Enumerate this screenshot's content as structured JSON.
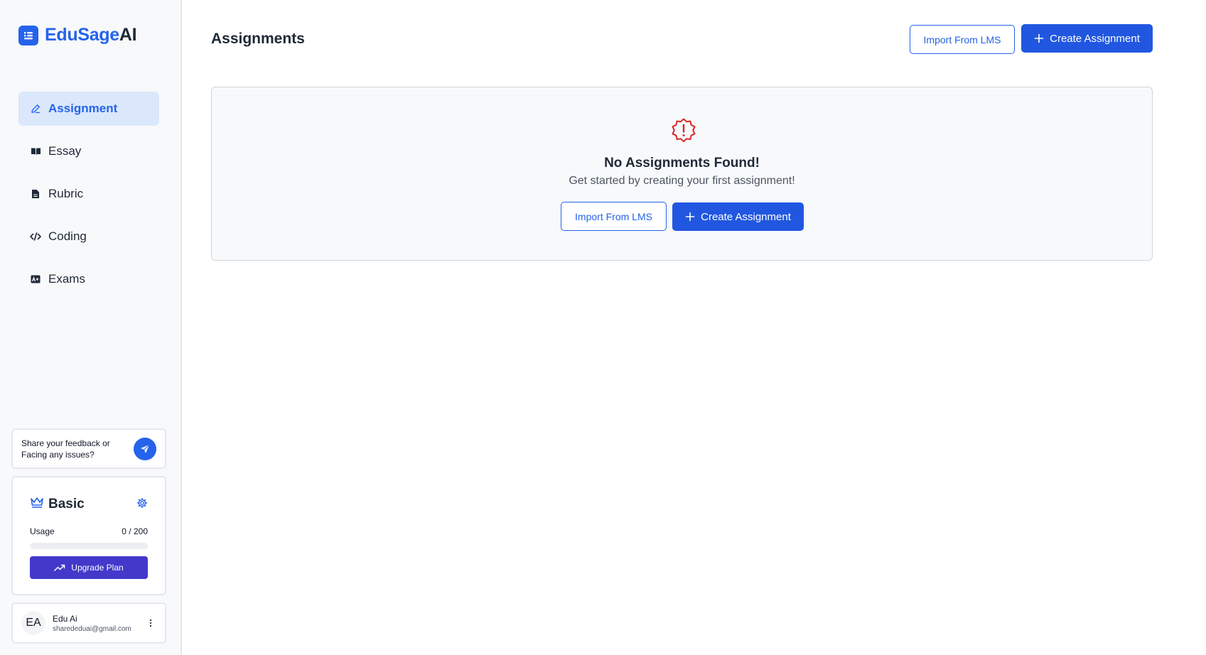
{
  "app": {
    "name_part1": "EduSage",
    "name_part2": "AI"
  },
  "sidebar": {
    "nav": [
      {
        "label": "Assignment",
        "icon": "pencil-icon",
        "active": true
      },
      {
        "label": "Essay",
        "icon": "book-icon",
        "active": false
      },
      {
        "label": "Rubric",
        "icon": "document-icon",
        "active": false
      },
      {
        "label": "Coding",
        "icon": "code-icon",
        "active": false
      },
      {
        "label": "Exams",
        "icon": "exam-icon",
        "active": false
      }
    ],
    "feedback": {
      "text": "Share your feedback or Facing any issues?",
      "icon": "send-icon"
    },
    "plan": {
      "name": "Basic",
      "usage_label": "Usage",
      "usage_value": "0 / 200",
      "usage_fraction": 0,
      "upgrade_label": "Upgrade Plan"
    },
    "user": {
      "initials": "EA",
      "name": "Edu Ai",
      "email": "sharededuai@gmail.com"
    }
  },
  "main": {
    "title": "Assignments",
    "import_label": "Import From LMS",
    "create_label": "Create Assignment",
    "empty": {
      "title": "No Assignments Found!",
      "subtitle": "Get started by creating your first assignment!",
      "import_label": "Import From LMS",
      "create_label": "Create Assignment"
    }
  },
  "colors": {
    "accent": "#2563eb",
    "upgrade": "#4338ca",
    "warning": "#dc2626",
    "sidebar_bg": "#f8f9fb"
  }
}
